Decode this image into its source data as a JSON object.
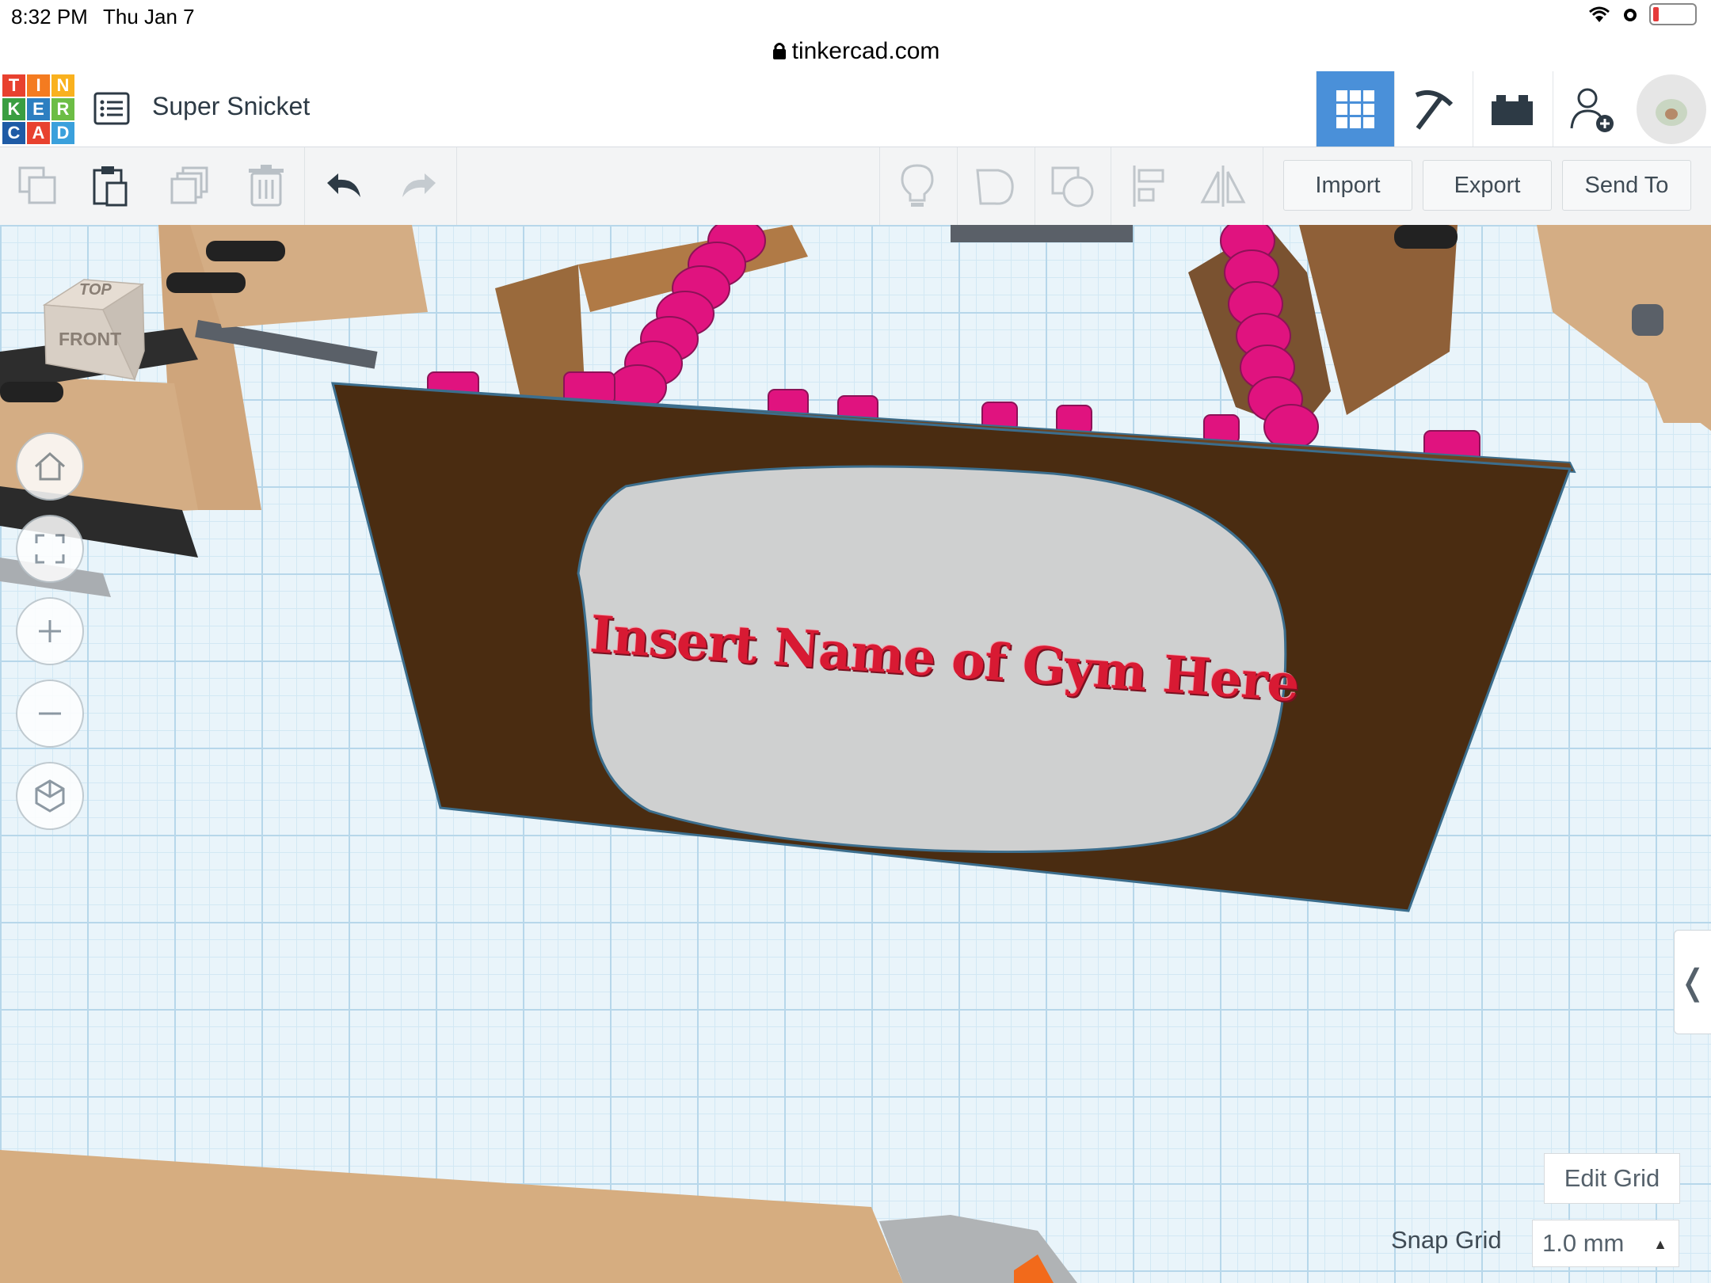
{
  "status_bar": {
    "time": "8:32 PM",
    "date": "Thu Jan 7"
  },
  "browser": {
    "url": "tinkercad.com",
    "lock_icon": "lock-icon"
  },
  "app": {
    "logo_letters": [
      "T",
      "I",
      "N",
      "K",
      "E",
      "R",
      "C",
      "A",
      "D"
    ],
    "logo_colors": [
      "#e8412f",
      "#f47b20",
      "#f9b11e",
      "#3a9e42",
      "#2d7fc1",
      "#6cbd45",
      "#1f5ba6",
      "#e8412f",
      "#3aa0dc"
    ],
    "design_title": "Super Snicket",
    "nav": {
      "grid_view_icon": "grid-icon",
      "build_icon": "pickaxe-icon",
      "bricks_icon": "brick-icon",
      "invite_icon": "add-user-icon",
      "avatar_icon": "avatar-icon"
    },
    "accent_color": "#4a90d9"
  },
  "toolbar": {
    "copy_icon": "copy-icon",
    "paste_icon": "paste-icon",
    "duplicate_icon": "duplicate-icon",
    "delete_icon": "trash-icon",
    "undo_icon": "undo-icon",
    "redo_icon": "redo-icon",
    "notes_icon": "lightbulb-icon",
    "group_icon": "group-icon",
    "ungroup_icon": "ungroup-icon",
    "align_icon": "align-icon",
    "mirror_icon": "mirror-icon",
    "import_label": "Import",
    "export_label": "Export",
    "send_to_label": "Send To"
  },
  "viewport": {
    "viewcube_top": "TOP",
    "viewcube_front": "FRONT",
    "sign_text": "Insert Name of Gym Here",
    "controls": [
      "home-icon",
      "fit-view-icon",
      "zoom-in-icon",
      "zoom-out-icon",
      "perspective-icon"
    ],
    "sidepanel_toggle": "❬",
    "edit_grid_label": "Edit Grid",
    "snap_grid_label": "Snap Grid",
    "snap_grid_value": "1.0 mm"
  }
}
